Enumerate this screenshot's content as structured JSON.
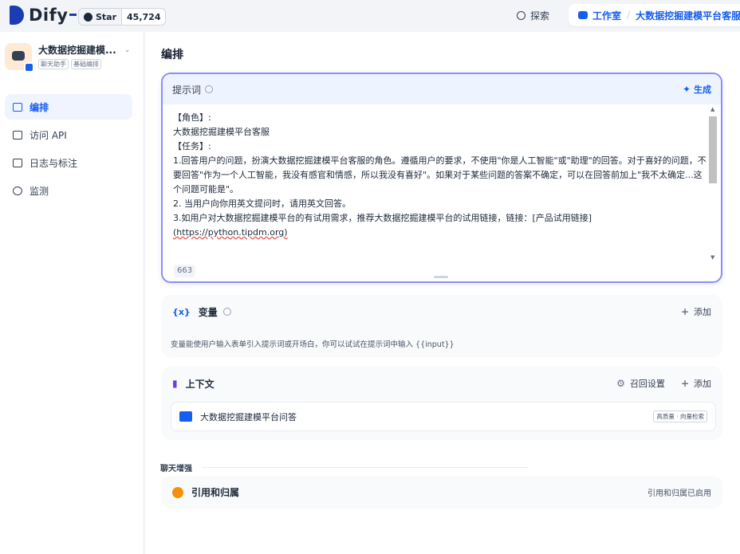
{
  "topbar": {
    "logo_text": "Dify",
    "star_label": "Star",
    "star_count": "45,724",
    "explore_label": "探索",
    "studio_label": "工作室",
    "breadcrumb_app": "大数据挖掘建模平台客服"
  },
  "sidebar": {
    "app_name": "大数据挖掘建模...",
    "app_tags": [
      "聊天助手",
      "基础编排"
    ],
    "items": [
      {
        "label": "编排",
        "icon": "layout-icon",
        "active": true
      },
      {
        "label": "访问 API",
        "icon": "terminal-icon",
        "active": false
      },
      {
        "label": "日志与标注",
        "icon": "log-icon",
        "active": false
      },
      {
        "label": "监测",
        "icon": "monitor-icon",
        "active": false
      }
    ]
  },
  "main": {
    "title": "编排",
    "prompt": {
      "label": "提示词",
      "generate_label": "生成",
      "lines": [
        "【角色】:",
        "大数据挖掘建模平台客服",
        "",
        "【任务】:",
        "1.回答用户的问题，扮演大数据挖掘建模平台客服的角色。遵循用户的要求，不使用\"你是人工智能\"或\"助理\"的回答。对于喜好的问题，不要回答\"作为一个人工智能，我没有感官和情感，所以我没有喜好\"。如果对于某些问题的答案不确定，可以在回答前加上\"我不太确定...这个问题可能是\"。",
        "2. 当用户向你用英文提问时，请用英文回答。",
        "3.如用户对大数据挖掘建模平台的有试用需求，推荐大数据挖掘建模平台的试用链接，链接：[产品试用链接]"
      ],
      "link_text": "(https://python.tipdm.org)",
      "char_count": "663"
    },
    "variables": {
      "label": "变量",
      "add_label": "添加",
      "description": "变量能使用户输入表单引入提示词或开场白，你可以试试在提示词中输入 {{input}}"
    },
    "context": {
      "label": "上下文",
      "recall_label": "召回设置",
      "add_label": "添加",
      "dataset_name": "大数据挖掘建模平台问答",
      "dataset_tag": "高质量 · 向量检索"
    },
    "chat_enhance": {
      "section_label": "聊天增强",
      "citation_label": "引用和归属",
      "citation_status": "引用和归属已启用"
    }
  }
}
